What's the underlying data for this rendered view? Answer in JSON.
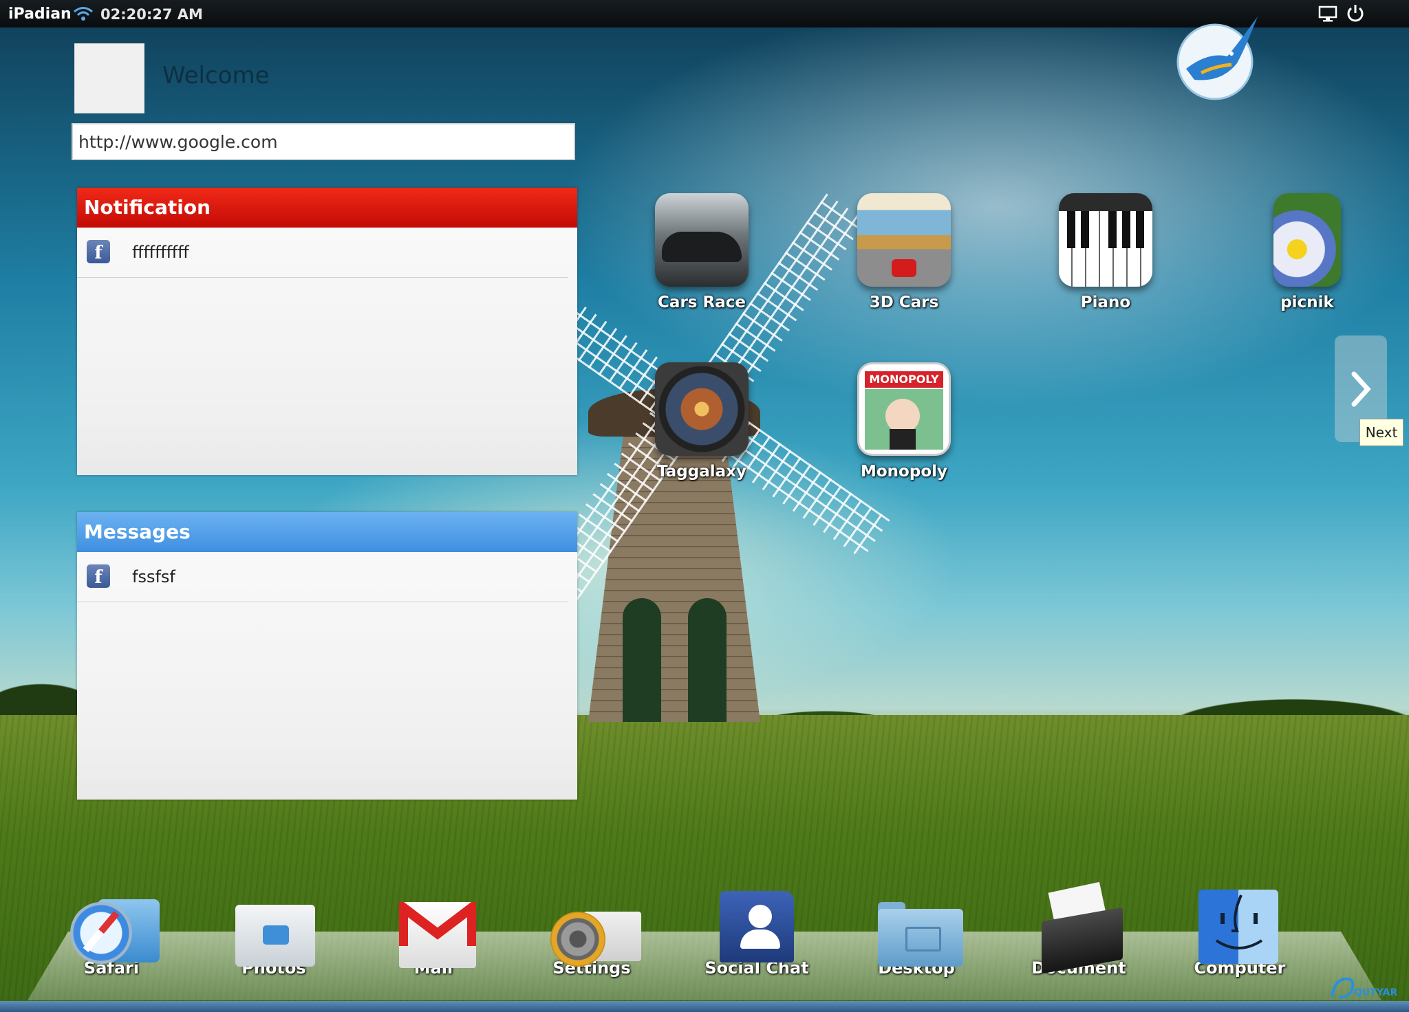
{
  "topbar": {
    "brand": "iPadian",
    "clock": "02:20:27 AM"
  },
  "welcome": {
    "title": "Welcome",
    "url_value": "http://www.google.com"
  },
  "notification": {
    "title": "Notification",
    "header_color": "#e8110f",
    "items": [
      {
        "text": "ffffffffff",
        "icon": "facebook-icon"
      }
    ]
  },
  "messages": {
    "title": "Messages",
    "header_color": "#4b9be6",
    "items": [
      {
        "text": "fssfsf",
        "icon": "facebook-icon"
      }
    ]
  },
  "apps": [
    {
      "label": "Cars Race",
      "icon": "cars-race-icon"
    },
    {
      "label": "3D Cars",
      "icon": "3d-cars-icon"
    },
    {
      "label": "Piano",
      "icon": "piano-icon"
    },
    {
      "label": "picnik",
      "icon": "picnik-icon"
    },
    {
      "label": "Taggalaxy",
      "icon": "taggalaxy-icon"
    },
    {
      "label": "Monopoly",
      "icon": "monopoly-icon",
      "logo_text": "MONOPOLY"
    }
  ],
  "next": {
    "tooltip": "Next"
  },
  "dock": [
    {
      "label": "Safari",
      "icon": "safari-icon"
    },
    {
      "label": "Photos",
      "icon": "photos-folder-icon"
    },
    {
      "label": "Mail",
      "icon": "gmail-icon"
    },
    {
      "label": "Settings",
      "icon": "settings-icon"
    },
    {
      "label": "Social Chat",
      "icon": "social-chat-icon"
    },
    {
      "label": "Desktop",
      "icon": "desktop-folder-icon"
    },
    {
      "label": "Document",
      "icon": "document-folder-icon"
    },
    {
      "label": "Computer",
      "icon": "finder-icon"
    }
  ],
  "watermark": {
    "text": "QUTYAR"
  }
}
